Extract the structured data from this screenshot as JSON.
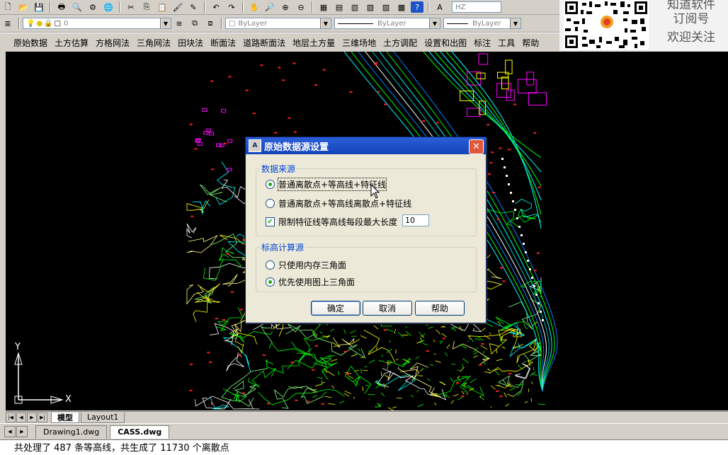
{
  "toolbar": {
    "layer_value": "0",
    "color_combo": "ByLayer",
    "linetype_combo": "ByLayer",
    "lineweight_combo": "ByLayer",
    "plotstyle_combo": "ByLayer",
    "font_combo": "HZ"
  },
  "menubar": {
    "items": [
      "原始数据",
      "土方估算",
      "方格网法",
      "三角网法",
      "田块法",
      "断面法",
      "道路断面法",
      "地层土方量",
      "三维场地",
      "土方调配",
      "设置和出图",
      "标注",
      "工具",
      "帮助"
    ]
  },
  "promo": {
    "line1": "知道软件",
    "line2": "订阅号",
    "line3": "欢迎关注"
  },
  "canvas": {
    "ucs_y": "Y",
    "ucs_x": "X"
  },
  "layout_tabs": {
    "model": "模型",
    "layout1": "Layout1"
  },
  "doc_tabs": {
    "items": [
      "Drawing1.dwg",
      "CASS.dwg"
    ]
  },
  "command_line": {
    "text": "共处理了 487 条等高线，共生成了 11730 个离散点"
  },
  "dialog": {
    "title": "原始数据源设置",
    "group1_label": "数据来源",
    "option1": "普通离散点+等高线+特征线",
    "option2": "普通离散点+等高线离散点+特征线",
    "checkbox_label": "限制特征线等高线每段最大长度",
    "max_length_value": "10",
    "group2_label": "标高计算源",
    "option3": "只使用内存三角面",
    "option4": "优先使用图上三角面",
    "ok_label": "确定",
    "cancel_label": "取消",
    "help_label": "帮助",
    "close_glyph": "✕",
    "icon_glyph": "A"
  },
  "colors": {
    "canvas_bg": "#000000",
    "title_bar": "#1f52c8",
    "radio_dot": "#21a121"
  }
}
